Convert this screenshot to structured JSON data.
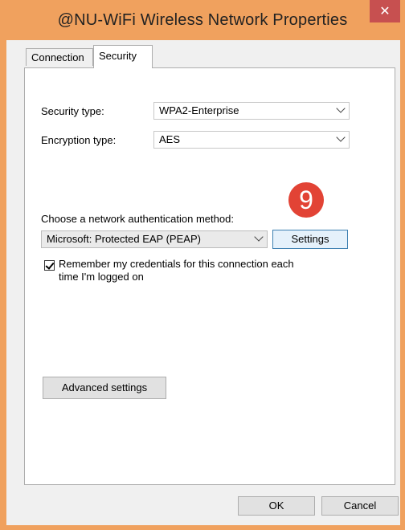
{
  "window": {
    "title": "@NU-WiFi Wireless Network Properties",
    "close_glyph": "✕"
  },
  "tabs": [
    {
      "label": "Connection",
      "active": false
    },
    {
      "label": "Security",
      "active": true
    }
  ],
  "security": {
    "security_type_label": "Security type:",
    "security_type_value": "WPA2-Enterprise",
    "encryption_type_label": "Encryption type:",
    "encryption_type_value": "AES",
    "auth_method_label": "Choose a network authentication method:",
    "auth_method_value": "Microsoft: Protected EAP (PEAP)",
    "settings_label": "Settings",
    "step_badge": "9",
    "remember_checked": true,
    "remember_line1": "Remember my credentials for this connection each",
    "remember_line2": "time I'm logged on",
    "advanced_label": "Advanced settings"
  },
  "footer": {
    "ok_label": "OK",
    "cancel_label": "Cancel"
  },
  "colors": {
    "frame": "#f0a15e",
    "close": "#c75050",
    "badge": "#e24335"
  }
}
